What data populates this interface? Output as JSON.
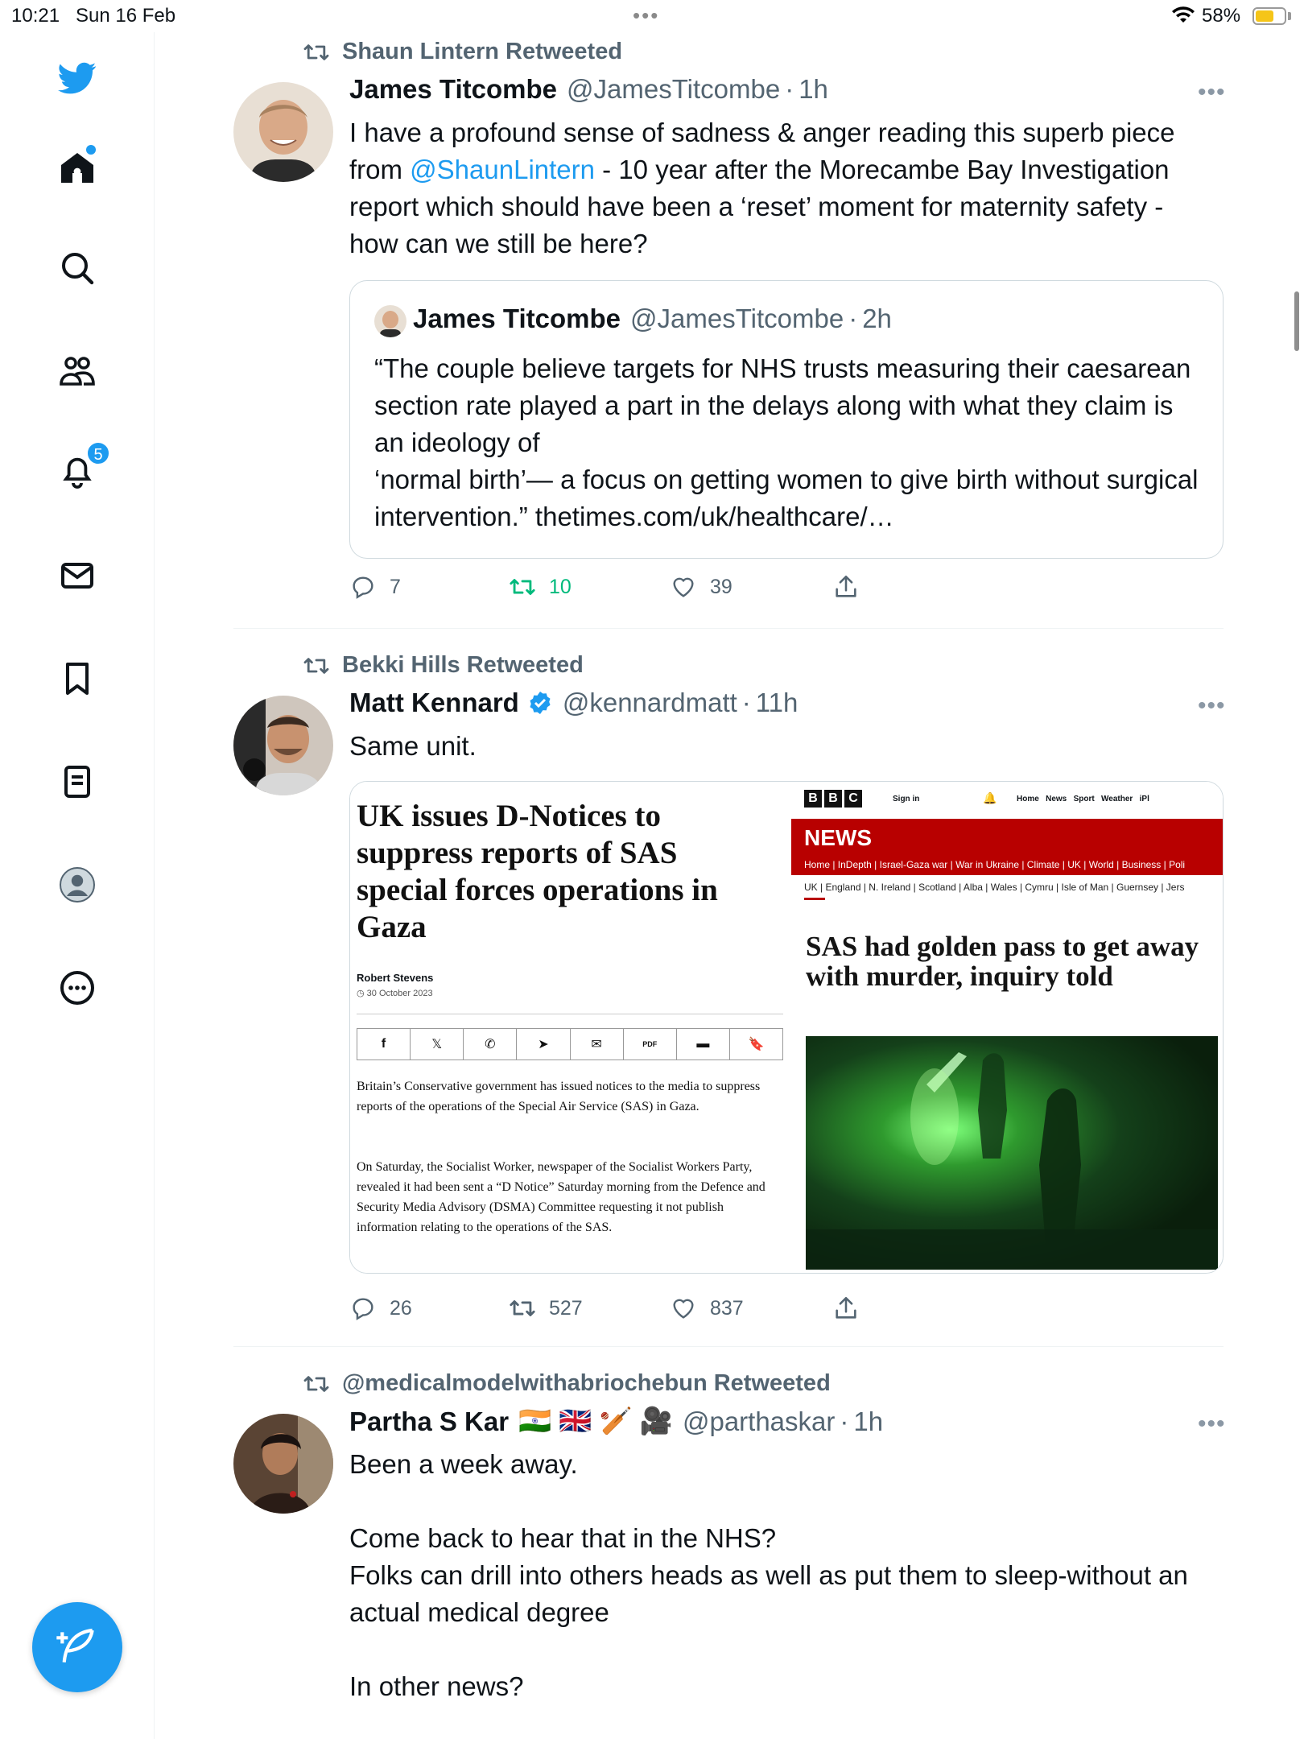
{
  "status_bar": {
    "time": "10:21",
    "date": "Sun 16 Feb",
    "dots": "•••",
    "battery": "58%"
  },
  "sidebar": {
    "notifications_badge": "5",
    "items": [
      "twitter-logo",
      "home",
      "search",
      "communities",
      "notifications",
      "messages",
      "bookmarks",
      "lists",
      "profile",
      "more"
    ]
  },
  "tweets": [
    {
      "retweeted_by": "Shaun Lintern Retweeted",
      "name": "James Titcombe",
      "handle": "@JamesTitcombe",
      "time": "1h",
      "text_pre": "I have a profound sense of sadness & anger reading this superb piece from ",
      "mention": "@ShaunLintern",
      "text_post": " - 10 year after the Morecambe Bay Investigation report which should have been a ‘reset’ moment for maternity safety - how can we still be here?",
      "quote": {
        "name": "James Titcombe",
        "handle": "@JamesTitcombe",
        "time": "2h",
        "text": "“The couple believe targets for NHS trusts measuring their caesarean section rate played a part in the delays along with what they claim is an ideology of\n‘normal birth’— a focus on getting women to give birth without surgical intervention.” thetimes.com/uk/healthcare/…"
      },
      "replies": "7",
      "retweets": "10",
      "likes": "39",
      "accent": "#00ba7c"
    },
    {
      "retweeted_by": "Bekki Hills Retweeted",
      "name": "Matt Kennard",
      "handle": "@kennardmatt",
      "time": "11h",
      "text": "Same unit.",
      "article": {
        "title": "UK issues D-Notices to suppress reports of SAS special forces operations in Gaza",
        "author": "Robert Stevens",
        "date": "30 October 2023",
        "share_icons": [
          "f",
          "𝕏",
          "✆",
          "➤",
          "✉",
          "PDF",
          "▬",
          "🔖"
        ],
        "p1": "Britain’s Conservative government has issued notices to the media to suppress reports of the operations of the Special Air Service (SAS) in Gaza.",
        "p2": "On Saturday, the Socialist Worker, newspaper of the Socialist Workers Party, revealed it had been sent a “D Notice” Saturday morning from the Defence and Security Media Advisory (DSMA) Committee requesting it not publish information relating to the operations of the SAS."
      },
      "bbc": {
        "logo": [
          "B",
          "B",
          "C"
        ],
        "signin": "Sign in",
        "top_links": "Home   News   Sport   Weather   iPl",
        "section": "NEWS",
        "links": "Home | InDepth | Israel-Gaza war | War in Ukraine | Climate | UK | World | Business | Poli",
        "sublinks": "UK | England | N. Ireland | Scotland | Alba | Wales | Cymru | Isle of Man | Guernsey | Jers",
        "headline": "SAS had golden pass to get away with murder, inquiry told"
      },
      "replies": "26",
      "retweets": "527",
      "likes": "837"
    },
    {
      "retweeted_by": "@medicalmodelwithabriochebun Retweeted",
      "name": "Partha S Kar",
      "emojis": "🇮🇳 🇬🇧 🏏 🎥",
      "handle": "@parthaskar",
      "time": "1h",
      "text": "Been a week away.\n\nCome back to hear that in the NHS?\nFolks can drill into others heads as well as put them to sleep-without an actual medical degree\n\nIn other news?"
    }
  ],
  "colors": {
    "accent": "#1d9bf0",
    "text": "#0f1419",
    "muted": "#536471",
    "retweet_green": "#00ba7c",
    "bbc_red": "#b80000"
  }
}
